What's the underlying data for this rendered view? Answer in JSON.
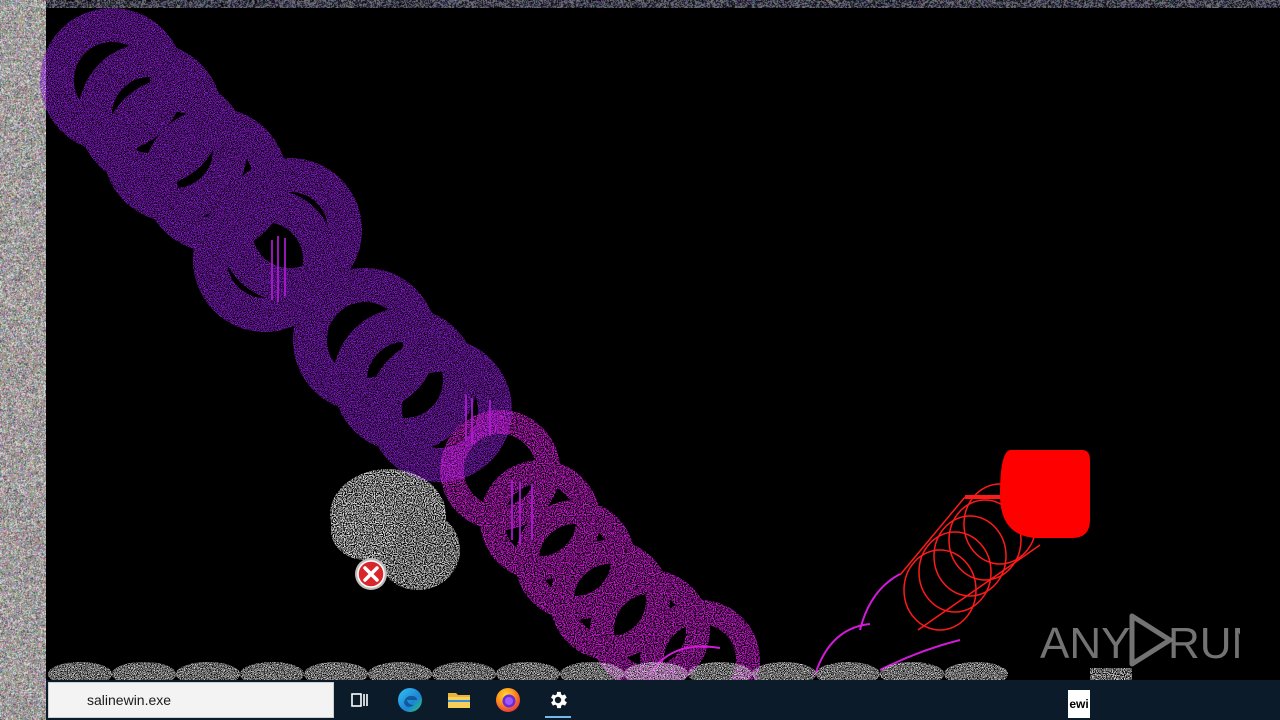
{
  "taskbar": {
    "search_text": "salinewin.exe",
    "apps": [
      {
        "name": "task-view",
        "label": "Task View"
      },
      {
        "name": "edge",
        "label": "Microsoft Edge"
      },
      {
        "name": "file-explorer",
        "label": "File Explorer"
      },
      {
        "name": "firefox",
        "label": "Firefox"
      },
      {
        "name": "settings",
        "label": "Settings",
        "active": true
      }
    ],
    "tray_fragment": "ewi"
  },
  "watermark": {
    "left": "ANY",
    "right": "RUN"
  },
  "colors": {
    "background": "#000000",
    "purple": "#8a1fd0",
    "magenta": "#c81ccf",
    "red": "#ff0000",
    "taskbar": "#0b1b2a",
    "accent": "#76b9ed"
  },
  "icons": {
    "error": "error-x-icon",
    "settings": "gear-icon"
  }
}
